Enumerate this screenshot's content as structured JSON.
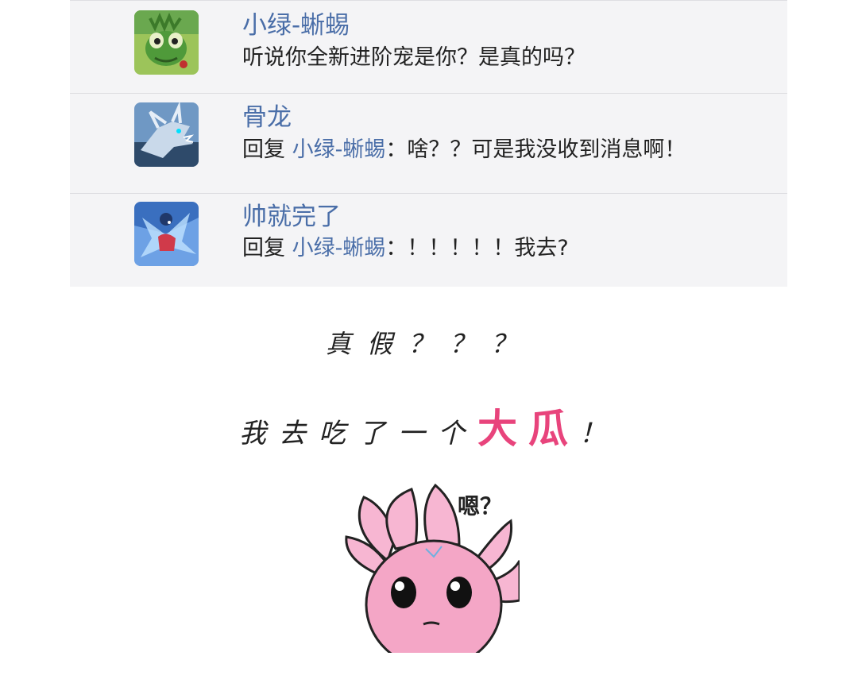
{
  "comments": [
    {
      "avatar": "green-lizard-avatar",
      "username": "小绿-蜥蜴",
      "text": "听说你全新进阶宠是你？是真的吗？",
      "reply_prefix": "",
      "mention": ""
    },
    {
      "avatar": "bone-dragon-avatar",
      "username": "骨龙",
      "reply_prefix": "回复 ",
      "mention": "小绿-蜥蜴",
      "text": "：啥？？可是我没收到消息啊！"
    },
    {
      "avatar": "blue-creature-avatar",
      "username": "帅就完了",
      "reply_prefix": "回复 ",
      "mention": "小绿-蜥蜴",
      "text": "：！！！！！我去?"
    }
  ],
  "caption1": "真假？？？",
  "caption2": {
    "before": "我去吃了一个",
    "highlight": "大瓜",
    "after": "！"
  },
  "sticker": {
    "icon": "pink-axolotl-sticker",
    "bubble_text": "嗯？"
  },
  "colors": {
    "username": "#4a6ea8",
    "highlight": "#e8447c",
    "panel_bg": "#f4f4f6"
  }
}
